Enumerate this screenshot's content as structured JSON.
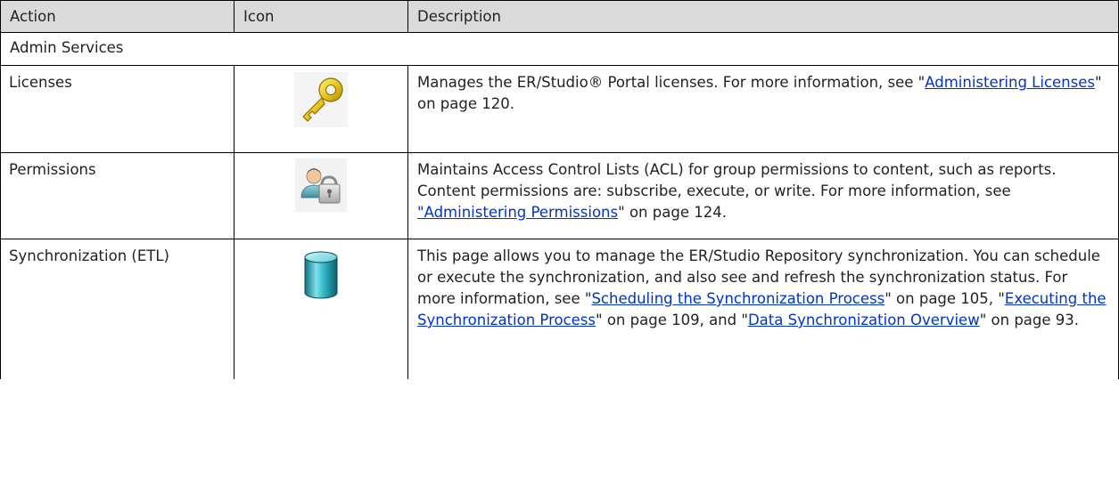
{
  "table": {
    "headers": {
      "action": "Action",
      "icon": "Icon",
      "description": "Description"
    },
    "section": "Admin Services",
    "rows": [
      {
        "action": "Licenses",
        "icon": "key-icon",
        "desc_before": "Manages the ER/Studio® Portal licenses. For more information, see \"",
        "link1": "Administering Licenses",
        "desc_after1": "\" on page 120."
      },
      {
        "action": "Permissions",
        "icon": "user-lock-icon",
        "desc_before": "Maintains Access Control Lists (ACL) for group permissions to content, such as reports. Content permissions are: subscribe, execute, or write. For more information, see ",
        "link1": "\"Administering Permissions",
        "desc_after1": "\" on page 124."
      },
      {
        "action": "Synchronization (ETL)",
        "icon": "database-icon",
        "desc_before": "This page allows you to manage the ER/Studio Repository synchronization. You can schedule or execute the synchronization, and also see and refresh the synchronization status. For more information, see \"",
        "link1": "Scheduling the Synchronization Process",
        "desc_after1": "\" on page 105, \"",
        "link2": "Executing the Synchronization Process",
        "desc_after2": "\" on page 109, and \"",
        "link3": "Data Synchronization Overview",
        "desc_after3": "\" on page 93."
      }
    ]
  }
}
